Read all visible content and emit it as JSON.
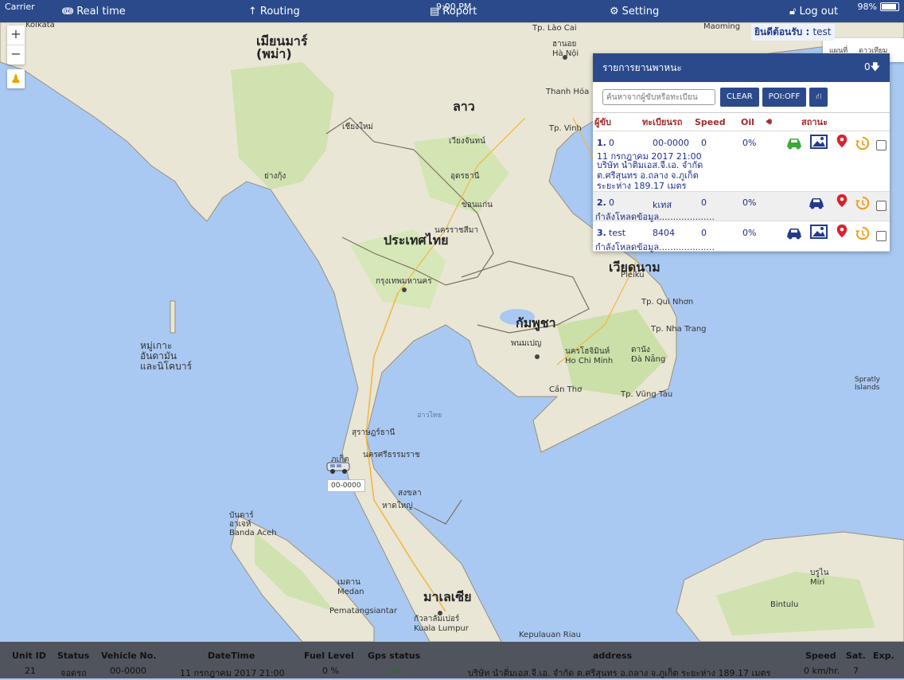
{
  "status_bar": {
    "carrier": "Carrier",
    "time": "9:00 PM",
    "battery": "98%"
  },
  "nav": {
    "realtime": "Real time",
    "routing": "Routing",
    "report": "Roport",
    "setting": "Setting",
    "logout": "Log out"
  },
  "map": {
    "zoom_in": "+",
    "zoom_out": "−",
    "welcome_label": "ยินดีต้อนรับ : ",
    "welcome_user": "test",
    "maptype": [
      "แผนที่",
      "ดาวเทียม"
    ],
    "labels": {
      "myanmar": "เมียนมาร์\n(พม่า)",
      "laos": "ลาว",
      "thailand": "ประเทศไทย",
      "cambodia": "กัมพูชา",
      "vietnam": "เวียดนาม",
      "malaysia": "มาเลเซีย",
      "kolkata": "Kolkata",
      "hanoi": "ฮานอย\nHà Nội",
      "bangkok": "กรุงเทพมหานคร",
      "hcm": "นครโฮจิมินห์\nHo Chi Minh",
      "kl": "กัวลาลัมเปอร์\nKuala Lumpur",
      "medan": "เมดาน\nMedan",
      "banda": "บันดาร์\nอาเจห์\nBanda Aceh",
      "andaman": "หมู่เกาะ\nอันดามัน\nและนิโคบาร์",
      "chiangmai": "เชียงใหม่",
      "vientiane": "เวียงจันทน์",
      "phnom": "พนมเปญ",
      "danang": "ดานัง\nĐà Nẵng",
      "pekanbaru": "Pematangsiantar",
      "singapore": "Kepulauan Riau",
      "bintulu": "Bintulu",
      "spratly": "Spratly\nIslands",
      "gulf": "อ่าวไทย",
      "miri": "บรูไน\nMiri",
      "laocai": "Tp. Lào Cai",
      "maoming": "Maoming",
      "thanhhoa": "Thanh Hóa",
      "vinh": "Tp. Vinh",
      "pleiku": "Pleiku",
      "quinhon": "Tp. Qui Nhơn",
      "nhatrang": "Tp. Nha Trang",
      "dalat": "Đà Lạt",
      "vungtau": "Tp. Vũng Tàu",
      "cantho": "Cần Thơ",
      "songkhla": "สงขลา",
      "hatyai": "หาดใหญ่",
      "nakhon": "นครศรีธรรมราช",
      "surat": "สุราษฎร์ธานี",
      "phuket": "ภูเก็ต",
      "korat": "นครราชสีมา",
      "khonkaen": "ขอนแก่น",
      "udon": "อุดรธานี",
      "yangon": "ย่างกุ้ง"
    },
    "car_label": "00-0000"
  },
  "panel": {
    "title": "รายการยานพาหนะ",
    "count": "0",
    "search_placeholder": "ค้นหาจากผู้ขับหรือทะเบียน",
    "btn_clear": "CLEAR",
    "btn_poi": "POI:OFF",
    "cols": {
      "driver": "ผู้ขับ",
      "plate": "ทะเบียนรถ",
      "speed": "Speed",
      "oil": "Oil",
      "status": "สถานะ"
    },
    "rows": [
      {
        "no": "1.",
        "driver": "0",
        "plate": "00-0000",
        "speed": "0",
        "oil": "0%",
        "date": "11 กรกฎาคม 2017 21:00",
        "addr1": "บริษัท นำติ่มเอส.จี.เอ. จำกัด",
        "addr2": "ต.ศรีสุนทร อ.ถลาง จ.ภูเก็ต",
        "addr3": "ระยะห่าง 189.17 เมตร",
        "car_color": "#3aa93a"
      },
      {
        "no": "2.",
        "driver": "0",
        "plate": "kเทส",
        "speed": "0",
        "oil": "0%",
        "loading": "กำลังโหลดข้อมูล....................",
        "car_color": "#223a8a"
      },
      {
        "no": "3.",
        "driver": "test",
        "plate": "8404",
        "speed": "0",
        "oil": "0%",
        "loading": "กำลังโหลดข้อมูล....................",
        "car_color": "#223a8a"
      }
    ]
  },
  "bottom": {
    "headers": {
      "unit": "Unit ID",
      "status": "Status",
      "vehicle": "Vehicle No.",
      "datetime": "DateTime",
      "fuel": "Fuel Level",
      "gps": "Gps status",
      "address": "address",
      "speed": "Speed",
      "sat": "Sat.",
      "exp": "Exp."
    },
    "values": {
      "unit": "21",
      "status": "จอดรถ",
      "vehicle": "00-0000",
      "datetime": "11 กรกฎาคม 2017 21:00",
      "fuel": "0 %",
      "gps": "On",
      "address": "บริษัท นำติ่มเอส.จี.เอ. จำกัด ต.ศรีสุนทร อ.ถลาง จ.ภูเก็ต ระยะห่าง 189.17 เมตร",
      "speed": "0 km/hr.",
      "sat": "7",
      "exp": ""
    }
  }
}
